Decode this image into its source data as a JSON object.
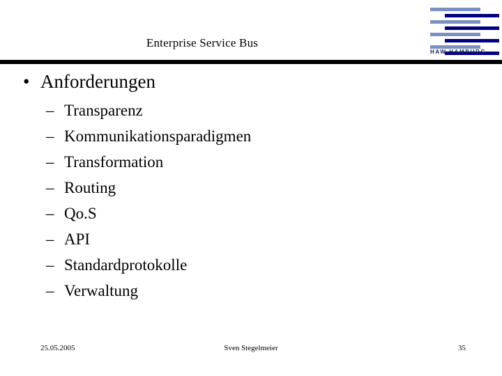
{
  "slide": {
    "title": "Enterprise Service Bus",
    "bullets": [
      {
        "label": "Anforderungen",
        "marker": "•",
        "children": [
          {
            "marker": "–",
            "label": "Transparenz"
          },
          {
            "marker": "–",
            "label": "Kommunikationsparadigmen"
          },
          {
            "marker": "–",
            "label": "Transformation"
          },
          {
            "marker": "–",
            "label": "Routing"
          },
          {
            "marker": "–",
            "label": "Qo.S"
          },
          {
            "marker": "–",
            "label": "API"
          },
          {
            "marker": "–",
            "label": "Standardprotokolle"
          },
          {
            "marker": "–",
            "label": "Verwaltung"
          }
        ]
      }
    ]
  },
  "logo": {
    "name": "haw-hamburg-logo",
    "wordmark": "HAW HAMBURG",
    "light_color": "#7b8fc0",
    "dark_color": "#000080"
  },
  "footer": {
    "date": "25.05.2005",
    "author": "Sven Stegelmeier",
    "page_number": "35"
  },
  "colors": {
    "background": "#ffffff",
    "text": "#000000",
    "rule": "#000000"
  }
}
